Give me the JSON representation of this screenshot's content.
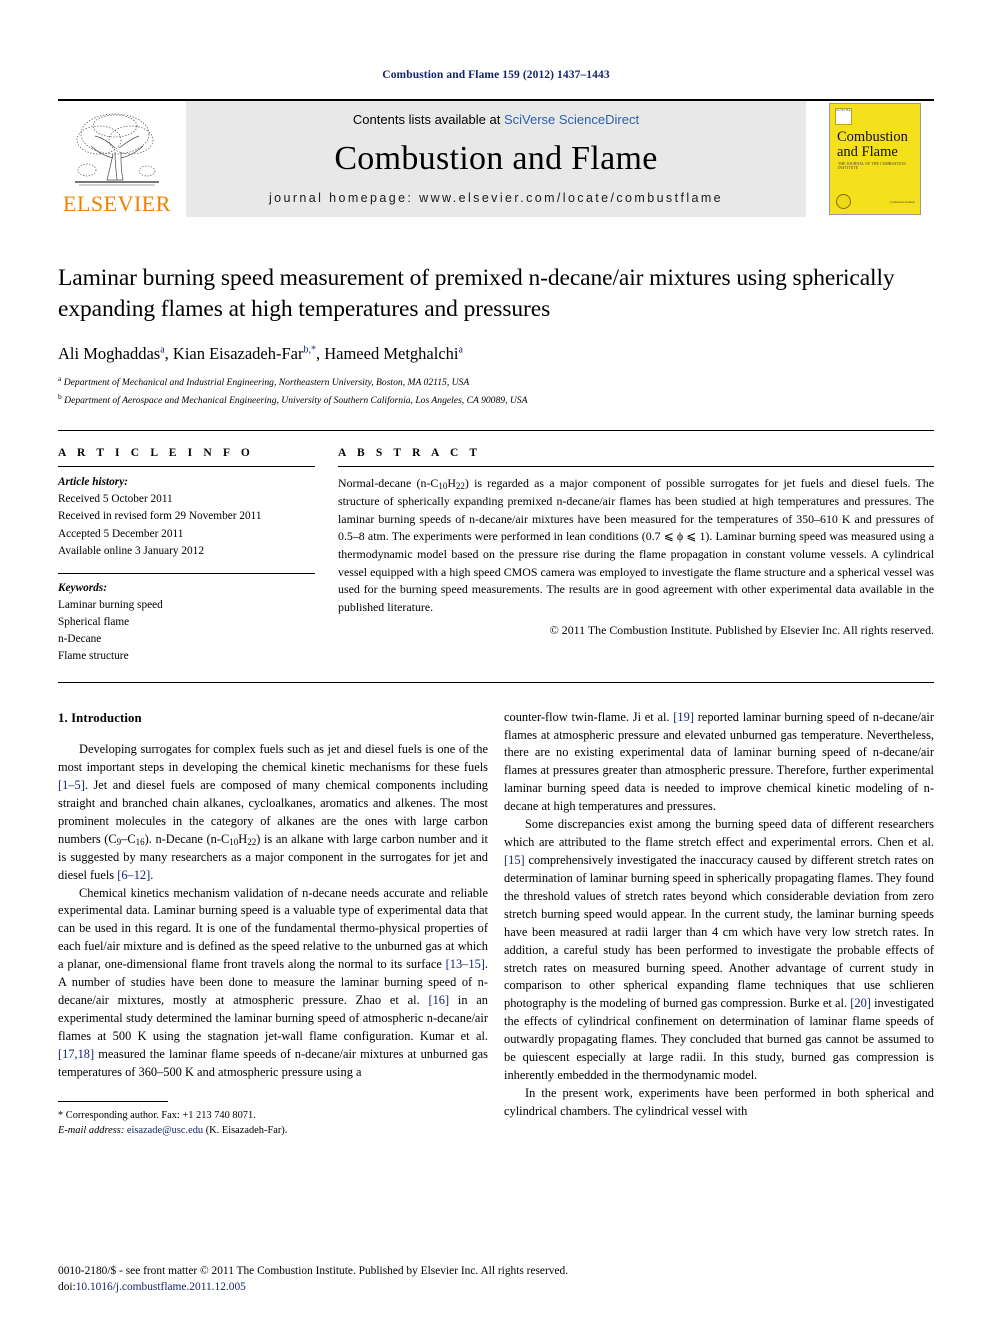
{
  "running_head": "Combustion and Flame 159 (2012) 1437–1443",
  "masthead": {
    "publisher_name": "ELSEVIER",
    "contents_prefix": "Contents lists available at ",
    "contents_link": "SciVerse ScienceDirect",
    "journal_title": "Combustion and Flame",
    "homepage_label": "journal homepage: www.elsevier.com/locate/combustflame",
    "cover": {
      "title_line1": "Combustion",
      "title_line2": "and Flame",
      "subtitle": "THE JOURNAL OF THE COMBUSTION INSTITUTE",
      "brand_mark": "ELSEVIER",
      "footer_mark": "Combustion Institute"
    }
  },
  "article": {
    "title": "Laminar burning speed measurement of premixed n-decane/air mixtures using spherically expanding flames at high temperatures and pressures",
    "authors_html": "Ali Moghaddas<sup>a</sup>, Kian Eisazadeh-Far<sup>b,*</sup>, Hameed Metghalchi<sup>a</sup>",
    "affiliation_a": "Department of Mechanical and Industrial Engineering, Northeastern University, Boston, MA 02115, USA",
    "affiliation_b": "Department of Aerospace and Mechanical Engineering, University of Southern California, Los Angeles, CA 90089, USA"
  },
  "info": {
    "heading": "A R T I C L E    I N F O",
    "history_label": "Article history:",
    "history": [
      "Received 5 October 2011",
      "Received in revised form 29 November 2011",
      "Accepted 5 December 2011",
      "Available online 3 January 2012"
    ],
    "keywords_label": "Keywords:",
    "keywords": [
      "Laminar burning speed",
      "Spherical flame",
      "n-Decane",
      "Flame structure"
    ]
  },
  "abstract": {
    "heading": "A B S T R A C T",
    "text": "Normal-decane (n-C10H22) is regarded as a major component of possible surrogates for jet fuels and diesel fuels. The structure of spherically expanding premixed n-decane/air flames has been studied at high temperatures and pressures. The laminar burning speeds of n-decane/air mixtures have been measured for the temperatures of 350–610 K and pressures of 0.5–8 atm. The experiments were performed in lean conditions (0.7 ⩽ ϕ ⩽ 1). Laminar burning speed was measured using a thermodynamic model based on the pressure rise during the flame propagation in constant volume vessels. A cylindrical vessel equipped with a high speed CMOS camera was employed to investigate the flame structure and a spherical vessel was used for the burning speed measurements. The results are in good agreement with other experimental data available in the published literature.",
    "copyright": "© 2011 The Combustion Institute. Published by Elsevier Inc. All rights reserved."
  },
  "body": {
    "section_heading": "1. Introduction",
    "left_paragraphs": [
      "Developing surrogates for complex fuels such as jet and diesel fuels is one of the most important steps in developing the chemical kinetic mechanisms for these fuels [1–5]. Jet and diesel fuels are composed of many chemical components including straight and branched chain alkanes, cycloalkanes, aromatics and alkenes. The most prominent molecules in the category of alkanes are the ones with large carbon numbers (C9–C16). n-Decane (n-C10H22) is an alkane with large carbon number and it is suggested by many researchers as a major component in the surrogates for jet and diesel fuels [6–12].",
      "Chemical kinetics mechanism validation of n-decane needs accurate and reliable experimental data. Laminar burning speed is a valuable type of experimental data that can be used in this regard. It is one of the fundamental thermo-physical properties of each fuel/air mixture and is defined as the speed relative to the unburned gas at which a planar, one-dimensional flame front travels along the normal to its surface [13–15]. A number of studies have been done to measure the laminar burning speed of n-decane/air mixtures, mostly at atmospheric pressure. Zhao et al. [16] in an experimental study determined the laminar burning speed of atmospheric n-decane/air flames at 500 K using the stagnation jet-wall flame configuration. Kumar et al. [17,18] measured the laminar flame speeds of n-decane/air mixtures at unburned gas temperatures of 360–500 K and atmospheric pressure using a"
    ],
    "right_paragraphs": [
      "counter-flow twin-flame. Ji et al. [19] reported laminar burning speed of n-decane/air flames at atmospheric pressure and elevated unburned gas temperature. Nevertheless, there are no existing experimental data of laminar burning speed of n-decane/air flames at pressures greater than atmospheric pressure. Therefore, further experimental laminar burning speed data is needed to improve chemical kinetic modeling of n-decane at high temperatures and pressures.",
      "Some discrepancies exist among the burning speed data of different researchers which are attributed to the flame stretch effect and experimental errors. Chen et al. [15] comprehensively investigated the inaccuracy caused by different stretch rates on determination of laminar burning speed in spherically propagating flames. They found the threshold values of stretch rates beyond which considerable deviation from zero stretch burning speed would appear. In the current study, the laminar burning speeds have been measured at radii larger than 4 cm which have very low stretch rates. In addition, a careful study has been performed to investigate the probable effects of stretch rates on measured burning speed. Another advantage of current study in comparison to other spherical expanding flame techniques that use schlieren photography is the modeling of burned gas compression. Burke et al. [20] investigated the effects of cylindrical confinement on determination of laminar flame speeds of outwardly propagating flames. They concluded that burned gas cannot be assumed to be quiescent especially at large radii. In this study, burned gas compression is inherently embedded in the thermodynamic model.",
      "In the present work, experiments have been performed in both spherical and cylindrical chambers. The cylindrical vessel with"
    ]
  },
  "footnote": {
    "corresponding": "* Corresponding author. Fax: +1 213 740 8071.",
    "email_label": "E-mail address:",
    "email": "eisazade@usc.edu",
    "email_suffix": "(K. Eisazadeh-Far)."
  },
  "page_footer": {
    "line1": "0010-2180/$ - see front matter © 2011 The Combustion Institute. Published by Elsevier Inc. All rights reserved.",
    "doi_label": "doi:",
    "doi": "10.1016/j.combustflame.2011.12.005"
  },
  "colors": {
    "link": "#2b5fb0",
    "reference": "#14246b",
    "elsevier_orange": "#f08000",
    "cover_yellow": "#f5e01c",
    "masthead_gray": "#e8e8e8"
  }
}
